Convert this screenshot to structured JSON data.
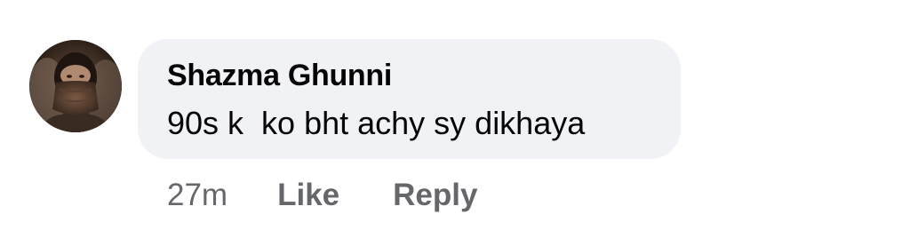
{
  "comment": {
    "author": "Shazma Ghunni",
    "text": "90s k  ko bht achy sy dikhaya",
    "time": "27m",
    "like_label": "Like",
    "reply_label": "Reply"
  },
  "colors": {
    "bubble_bg": "#f0f2f5",
    "text": "#050505",
    "meta": "#65676b"
  }
}
